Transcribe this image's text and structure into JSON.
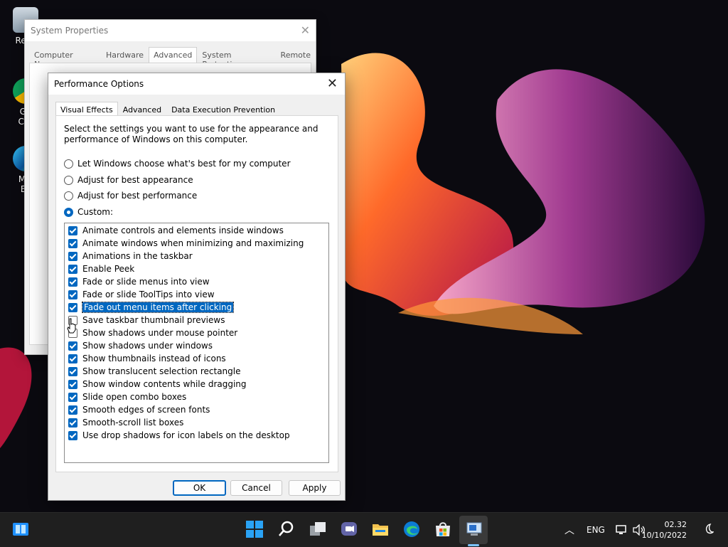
{
  "desktop": {
    "icons": [
      {
        "label": "Recy"
      },
      {
        "label": "Go Chr"
      },
      {
        "label": "Mic Ec"
      }
    ]
  },
  "system_properties": {
    "title": "System Properties",
    "tabs": [
      "Computer Name",
      "Hardware",
      "Advanced",
      "System Protection",
      "Remote"
    ],
    "active_tab": "Advanced"
  },
  "performance_options": {
    "title": "Performance Options",
    "tabs": [
      "Visual Effects",
      "Advanced",
      "Data Execution Prevention"
    ],
    "active_tab": "Visual Effects",
    "description": "Select the settings you want to use for the appearance and performance of Windows on this computer.",
    "radios": [
      {
        "label": "Let Windows choose what's best for my computer",
        "checked": false
      },
      {
        "label": "Adjust for best appearance",
        "checked": false
      },
      {
        "label": "Adjust for best performance",
        "checked": false
      },
      {
        "label": "Custom:",
        "checked": true
      }
    ],
    "effects": [
      {
        "label": "Animate controls and elements inside windows",
        "checked": true
      },
      {
        "label": "Animate windows when minimizing and maximizing",
        "checked": true
      },
      {
        "label": "Animations in the taskbar",
        "checked": true
      },
      {
        "label": "Enable Peek",
        "checked": true
      },
      {
        "label": "Fade or slide menus into view",
        "checked": true
      },
      {
        "label": "Fade or slide ToolTips into view",
        "checked": true
      },
      {
        "label": "Fade out menu items after clicking",
        "checked": true,
        "selected": true
      },
      {
        "label": "Save taskbar thumbnail previews",
        "checked": false
      },
      {
        "label": "Show shadows under mouse pointer",
        "checked": false
      },
      {
        "label": "Show shadows under windows",
        "checked": true
      },
      {
        "label": "Show thumbnails instead of icons",
        "checked": true
      },
      {
        "label": "Show translucent selection rectangle",
        "checked": true
      },
      {
        "label": "Show window contents while dragging",
        "checked": true
      },
      {
        "label": "Slide open combo boxes",
        "checked": true
      },
      {
        "label": "Smooth edges of screen fonts",
        "checked": true
      },
      {
        "label": "Smooth-scroll list boxes",
        "checked": true
      },
      {
        "label": "Use drop shadows for icon labels on the desktop",
        "checked": true
      }
    ],
    "buttons": {
      "ok": "OK",
      "cancel": "Cancel",
      "apply": "Apply"
    }
  },
  "taskbar": {
    "tray": {
      "language": "ENG"
    },
    "clock": {
      "time": "02.32",
      "date": "10/10/2022"
    }
  },
  "colors": {
    "accent": "#0067c0",
    "taskbar": "#1f1f1f"
  }
}
